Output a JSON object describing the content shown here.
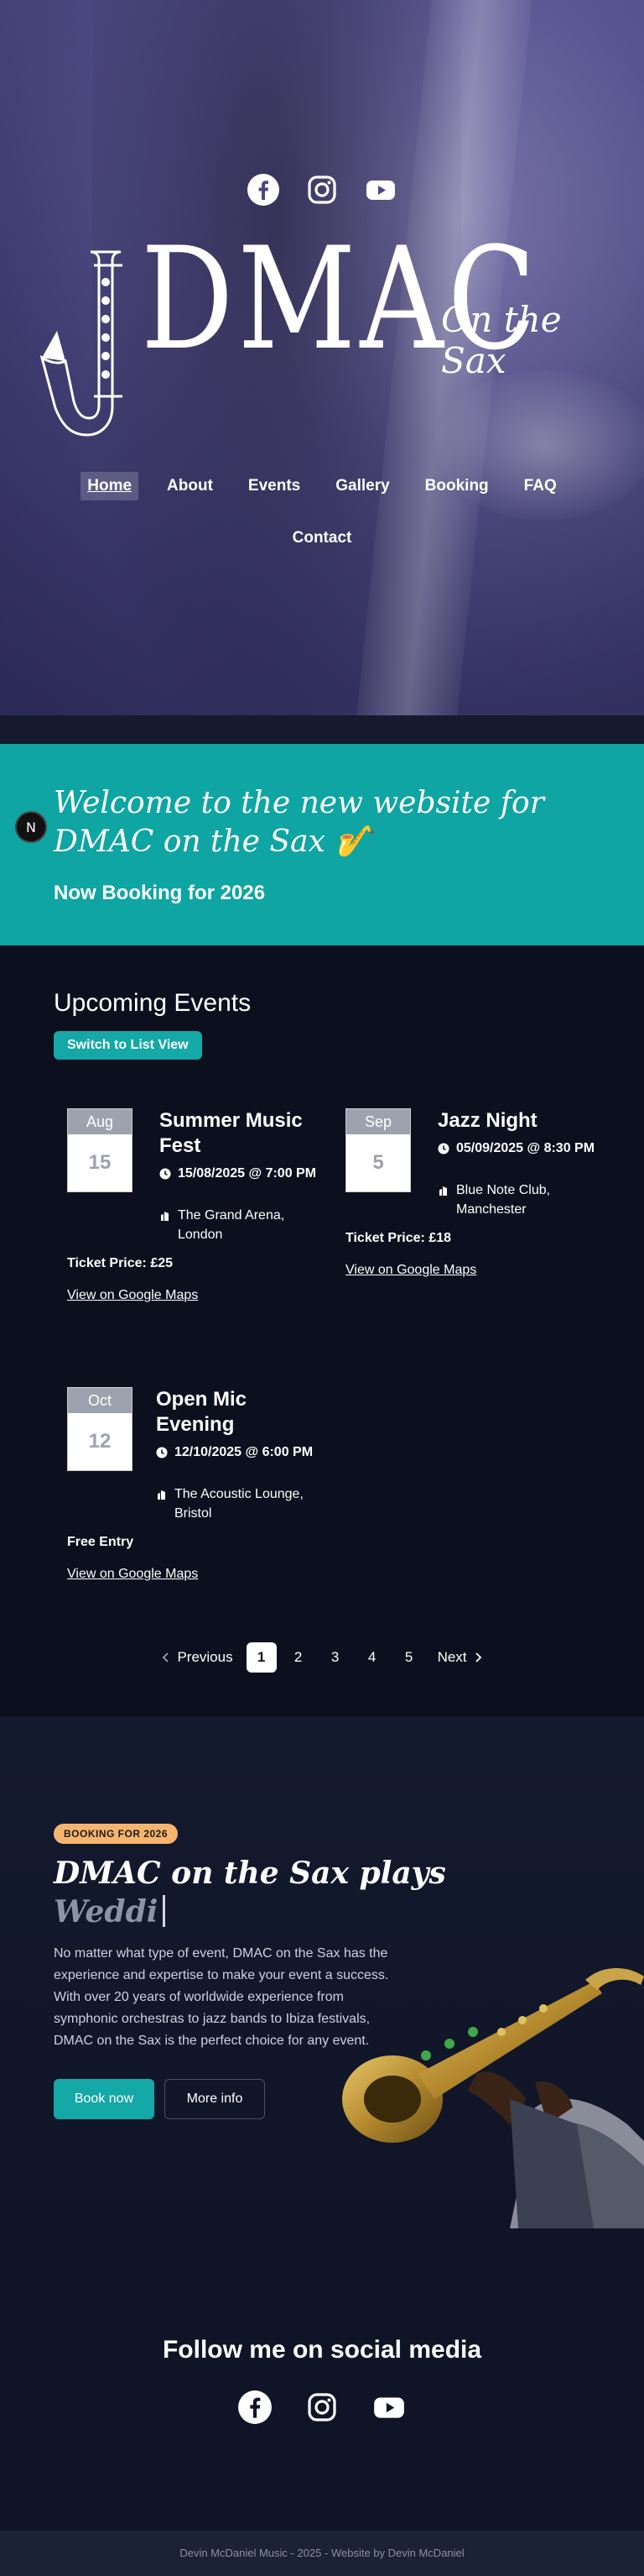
{
  "hero": {
    "logo_text": "DMAC",
    "logo_sub": "On the Sax",
    "social_icons": [
      "facebook-icon",
      "instagram-icon",
      "youtube-icon"
    ]
  },
  "nav": {
    "items": [
      "Home",
      "About",
      "Events",
      "Gallery",
      "Booking",
      "FAQ",
      "Contact"
    ],
    "active": "Home"
  },
  "welcome": {
    "heading": "Welcome to the new website for DMAC on the Sax 🎷",
    "subheading": "Now Booking for 2026"
  },
  "next_badge": "N",
  "events": {
    "heading": "Upcoming Events",
    "switch_label": "Switch to List View",
    "items": [
      {
        "month": "Aug",
        "day": "15",
        "title": "Summer Music Fest",
        "datetime": "15/08/2025 @ 7:00 PM",
        "venue": "The Grand Arena, London",
        "price": "Ticket Price: £25",
        "map_link": "View on Google Maps"
      },
      {
        "month": "Sep",
        "day": "5",
        "title": "Jazz Night",
        "datetime": "05/09/2025 @ 8:30 PM",
        "venue": "Blue Note Club, Manchester",
        "price": "Ticket Price: £18",
        "map_link": "View on Google Maps"
      },
      {
        "month": "Oct",
        "day": "12",
        "title": "Open Mic Evening",
        "datetime": "12/10/2025 @ 6:00 PM",
        "venue": "The Acoustic Lounge, Bristol",
        "price": "Free Entry",
        "map_link": "View on Google Maps"
      }
    ],
    "pagination": {
      "previous": "Previous",
      "pages": [
        "1",
        "2",
        "3",
        "4",
        "5"
      ],
      "current": "1",
      "next": "Next"
    }
  },
  "booking": {
    "pill": "BOOKING FOR 2026",
    "heading": "DMAC on the Sax plays",
    "typed": "Weddi",
    "body": "No matter what type of event, DMAC on the Sax has the experience and expertise to make your event a success. With over 20 years of worldwide experience from symphonic orchestras to jazz bands to Ibiza festivals, DMAC on the Sax is the perfect choice for any event.",
    "book_now": "Book now",
    "more_info": "More info"
  },
  "social": {
    "heading": "Follow me on social media",
    "icons": [
      "facebook-icon",
      "instagram-icon",
      "youtube-icon"
    ]
  },
  "footer": {
    "text": "Devin McDaniel Music - 2025 - Website by Devin McDaniel"
  },
  "colors": {
    "accent": "#14a8a6",
    "hero_purple": "#5b5790",
    "page_bg": "#0b0f1e",
    "pill": "#f6b56f"
  }
}
